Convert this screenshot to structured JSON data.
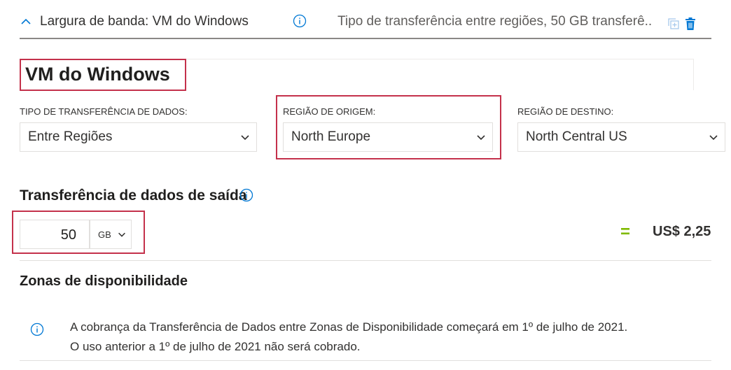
{
  "header": {
    "title": "Largura de banda: VM do Windows",
    "description": "Tipo de transferência entre regiões, 50 GB transferê..."
  },
  "name_field": {
    "value": "VM do Windows"
  },
  "fields": {
    "transfer_type": {
      "label": "TIPO DE TRANSFERÊNCIA DE DADOS:",
      "value": "Entre Regiões"
    },
    "source_region": {
      "label": "REGIÃO DE ORIGEM:",
      "value": "North Europe"
    },
    "dest_region": {
      "label": "REGIÃO DE DESTINO:",
      "value": "North Central US"
    }
  },
  "outbound": {
    "title": "Transferência de dados de saída",
    "quantity": "50",
    "unit": "GB",
    "equals": "=",
    "price": "US$ 2,25"
  },
  "availability": {
    "title": "Zonas de disponibilidade",
    "note_line1": "A cobrança da Transferência de Dados entre Zonas de Disponibilidade começará em 1º de julho de 2021.",
    "note_line2": "O uso anterior a 1º de julho de 2021 não será cobrado."
  },
  "colors": {
    "accent_blue": "#0078d4",
    "highlight_red": "#c4314b",
    "equals_green": "#7fba00"
  },
  "icons": [
    "chevron-up-icon",
    "info-icon",
    "clone-icon",
    "trash-icon",
    "chevron-down-icon"
  ]
}
